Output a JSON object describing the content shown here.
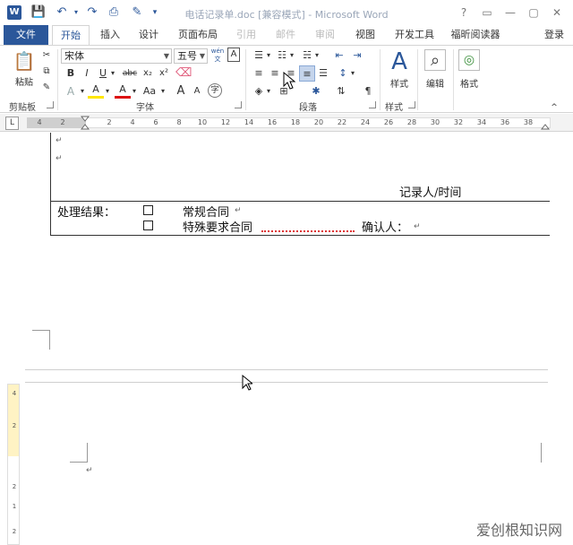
{
  "titlebar": {
    "app_icon": "W",
    "title": "电话记录单.doc [兼容模式] - Microsoft Word",
    "quick_access": [
      "save-icon",
      "undo-icon",
      "redo-icon",
      "print-preview-icon",
      "format-painter-icon",
      "customize-icon"
    ],
    "window_buttons": [
      "?",
      "▭",
      "—",
      "▢",
      "✕"
    ]
  },
  "tabs": {
    "file": "文件",
    "items": [
      "开始",
      "插入",
      "设计",
      "页面布局",
      "引用",
      "邮件",
      "审阅",
      "视图",
      "开发工具",
      "福昕阅读器"
    ],
    "active": "开始",
    "login": "登录"
  },
  "ribbon": {
    "clipboard": {
      "paste": "粘贴",
      "label": "剪贴板"
    },
    "font": {
      "font_name": "宋体",
      "font_size": "五号",
      "label": "字体",
      "phonetic": "wén",
      "bold": "B",
      "italic": "I",
      "underline": "U",
      "strike": "abc",
      "subscript": "x₂",
      "superscript": "x²",
      "change_case": "Aa",
      "grow": "A",
      "shrink": "A",
      "font_color": "A",
      "highlight": "A",
      "enclose": "字"
    },
    "paragraph": {
      "label": "段落"
    },
    "styles": {
      "label": "样式",
      "button": "样式"
    },
    "editing": {
      "button": "编辑"
    },
    "format": {
      "button": "格式"
    }
  },
  "ruler": {
    "corner": "L",
    "numbers": [
      "4",
      "2",
      "2",
      "4",
      "6",
      "8",
      "10",
      "12",
      "14",
      "16",
      "18",
      "20",
      "22",
      "24",
      "26",
      "28",
      "30",
      "32",
      "34",
      "36",
      "38"
    ]
  },
  "vruler_numbers": [
    "4",
    "2",
    "2",
    "1",
    "2"
  ],
  "document": {
    "recorder": "记录人/时间",
    "result_label": "处理结果：",
    "option1": "常规合同",
    "option2": "特殊要求合同",
    "confirm": "确认人：",
    "para_mark": "↵"
  },
  "watermark": "爱创根知识网"
}
